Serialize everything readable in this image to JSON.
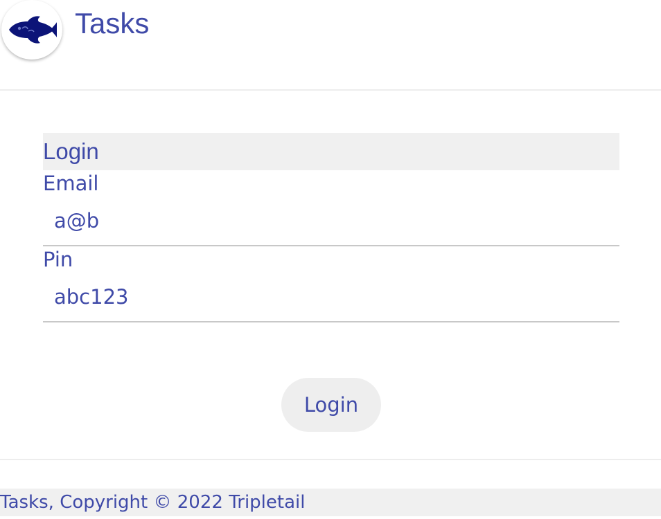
{
  "header": {
    "logo_icon": "fish-logo-icon",
    "title": "Tasks"
  },
  "login_form": {
    "title": "Login",
    "email": {
      "label": "Email",
      "value": "a@b"
    },
    "pin": {
      "label": "Pin",
      "value": "abc123"
    },
    "submit_label": "Login"
  },
  "footer": {
    "text": "Tasks, Copyright © 2022 Tripletail"
  },
  "colors": {
    "primary_text": "#3f4aa8",
    "logo_fish": "#0c1478",
    "panel_background": "#f0f0f0"
  }
}
